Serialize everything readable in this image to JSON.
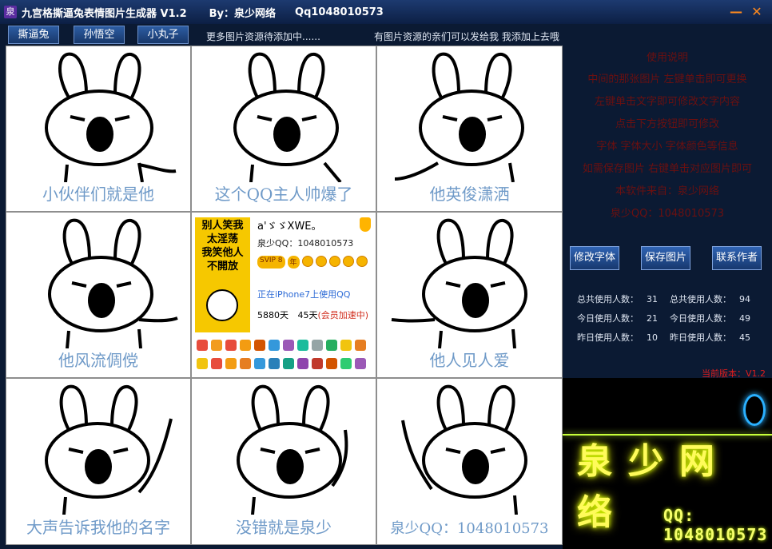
{
  "titlebar": {
    "icon_glyph": "泉",
    "title": "九宫格撕逼兔表情图片生成器 V1.2",
    "author": "By：泉少网络",
    "qq": "Qq1048010573",
    "minimize": "—",
    "close": "✕"
  },
  "toolbar": {
    "buttons": [
      "撕逼兔",
      "孙悟空",
      "小丸子"
    ],
    "note_left": "更多图片资源待添加中......",
    "note_right": "有图片资源的亲们可以发给我 我添加上去哦"
  },
  "grid": {
    "captions": [
      "小伙伴们就是他",
      "这个QQ主人帅爆了",
      "他英俊潇洒",
      "他风流倜傥",
      "",
      "他人见人爱",
      "大声告诉我他的名字",
      "没错就是泉少",
      "泉少QQ：1048010573"
    ]
  },
  "qq_card": {
    "poster_text": "别人笑我\n太淫荡\n我笑他人\n不開放",
    "nickname": "a'ゞゞXWE。",
    "qq_line": "泉少QQ：1048010573",
    "vip_badge": "SVIP 8",
    "year_badge": "年",
    "iphone_line": "正在iPhone7上使用QQ",
    "days": "5880天",
    "boost": "45天",
    "boost_note": "(会员加速中)"
  },
  "info": {
    "lines": [
      "使用说明",
      "中间的那张图片 左键单击即可更换",
      "左键单击文字即可修改文字内容",
      "点击下方按钮即可修改",
      "字体 字体大小 字体颜色等信息",
      "如需保存图片 右键单击对应图片即可",
      "本软件来自：泉少网络",
      "泉少QQ：1048010573"
    ],
    "buttons": [
      "修改字体",
      "保存图片",
      "联系作者"
    ],
    "stats": {
      "total_label": "总共使用人数：",
      "total_left": "31",
      "total_right": "94",
      "today_label": "今日使用人数：",
      "today_left": "21",
      "today_right": "49",
      "yesterday_label": "昨日使用人数：",
      "yesterday_left": "10",
      "yesterday_right": "45"
    },
    "version": "当前版本：V1.2"
  },
  "banner": {
    "title": "泉少网络",
    "qq": "QQ: 1048010573"
  }
}
